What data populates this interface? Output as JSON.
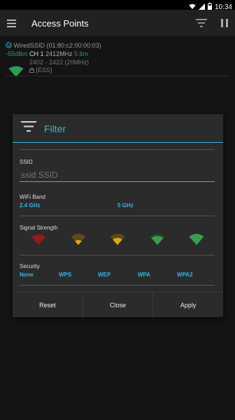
{
  "status": {
    "time": "10:34"
  },
  "appbar": {
    "title": "Access Points"
  },
  "ap": {
    "name_line": "WiredSSID (01:80:c2:00:00:03)",
    "rssi": "-55dBm",
    "ch": "CH 1",
    "freq": "2412MHz",
    "distance": "5.6m",
    "range": "2402 - 2422 (20MHz)",
    "security": "[ESS]",
    "colors": {
      "rssi": "#2e9b56",
      "dist": "#2e9b56",
      "ch": "#dddddd",
      "wifi": "#2e9b56"
    }
  },
  "filter": {
    "title": "Filter",
    "ssid_label": "SSID",
    "ssid_placeholder": "ssid SSID",
    "wifi_band_label": "WiFi Band",
    "band_options": [
      "2.4 GHz",
      "5 GHz"
    ],
    "signal_label": "Signal Strength",
    "signal_levels": [
      {
        "level": 1,
        "color": "#8b1f1f"
      },
      {
        "level": 2,
        "color": "#e0a41c"
      },
      {
        "level": 3,
        "color": "#e0a41c"
      },
      {
        "level": 4,
        "color": "#3a9c50"
      },
      {
        "level": 5,
        "color": "#3a9c50"
      }
    ],
    "security_label": "Security",
    "security_options": [
      "None",
      "WPS",
      "WEP",
      "WPA",
      "WPA2"
    ],
    "buttons": {
      "reset": "Reset",
      "close": "Close",
      "apply": "Apply"
    }
  }
}
